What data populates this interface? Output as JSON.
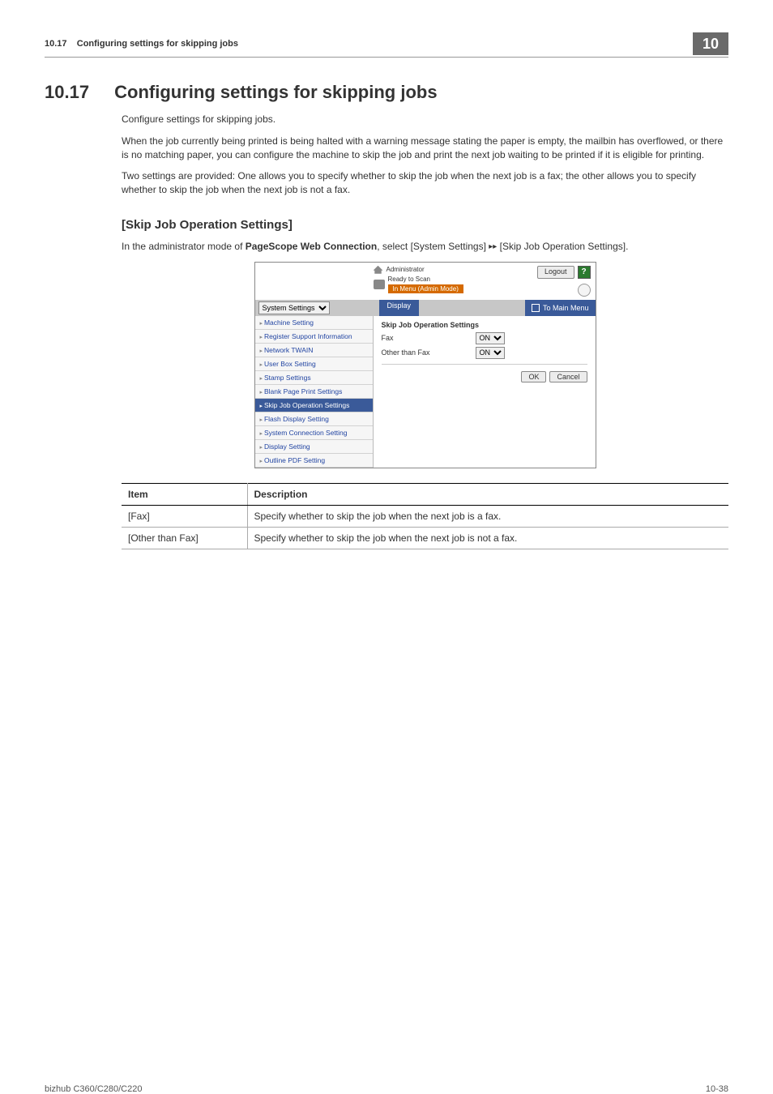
{
  "header": {
    "section_num": "10.17",
    "section_title": "Configuring settings for skipping jobs",
    "chapter_badge": "10"
  },
  "h1": {
    "num": "10.17",
    "title": "Configuring settings for skipping jobs"
  },
  "intro": {
    "p1": "Configure settings for skipping jobs.",
    "p2": "When the job currently being printed is being halted with a warning message stating the paper is empty, the mailbin has overflowed, or there is no matching paper, you can configure the machine to skip the job and print the next job waiting to be printed if it is eligible for printing.",
    "p3": "Two settings are provided: One allows you to specify whether to skip the job when the next job is a fax; the other allows you to specify whether to skip the job when the next job is not a fax."
  },
  "h2": "[Skip Job Operation Settings]",
  "instr": {
    "pre": "In the administrator mode of ",
    "bold": "PageScope Web Connection",
    "post": ", select [System Settings]  [Skip Job Operation Settings]."
  },
  "shot": {
    "admin_label": "Administrator",
    "logout": "Logout",
    "ready": "Ready to Scan",
    "orange": "In Menu (Admin Mode)",
    "dropdown": "System Settings",
    "tab": "Display",
    "main_menu": "To Main Menu",
    "side": {
      "i0": "Machine Setting",
      "i1": "Register Support Information",
      "i2": "Network TWAIN",
      "i3": "User Box Setting",
      "i4": "Stamp Settings",
      "i5": "Blank Page Print Settings",
      "i6": "Skip Job Operation Settings",
      "i7": "Flash Display Setting",
      "i8": "System Connection Setting",
      "i9": "Display Setting",
      "i10": "Outline PDF Setting"
    },
    "pane": {
      "head": "Skip Job Operation Settings",
      "row1": "Fax",
      "row2": "Other than Fax",
      "on": "ON",
      "ok": "OK",
      "cancel": "Cancel"
    }
  },
  "table": {
    "h1": "Item",
    "h2": "Description",
    "r1c1": "[Fax]",
    "r1c2": "Specify whether to skip the job when the next job is a fax.",
    "r2c1": "[Other than Fax]",
    "r2c2": "Specify whether to skip the job when the next job is not a fax."
  },
  "footer": {
    "left": "bizhub C360/C280/C220",
    "right": "10-38"
  }
}
